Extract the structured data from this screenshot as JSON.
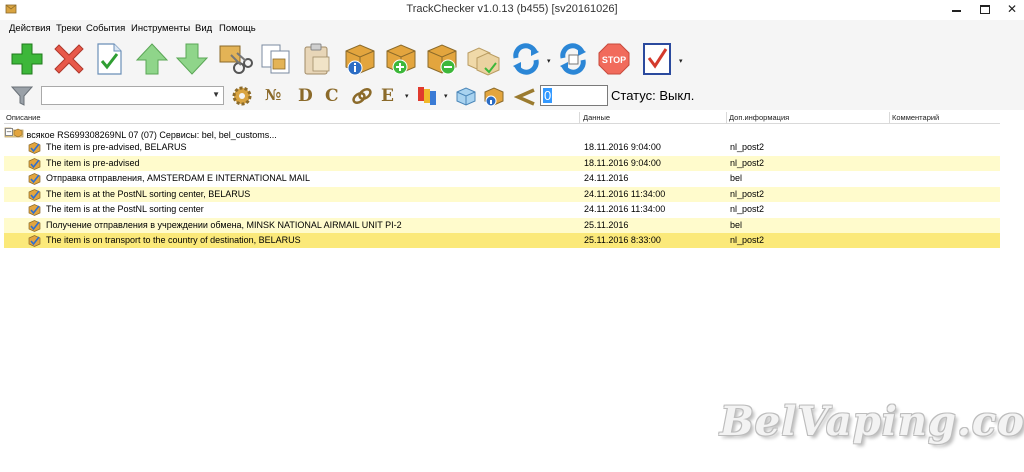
{
  "window": {
    "title": "TrackChecker v1.0.13 (b455)  [sv20161026]",
    "controls": [
      "—",
      "☐",
      "✕"
    ]
  },
  "menu": [
    "Действия",
    "Треки",
    "События",
    "Инструменты",
    "Вид",
    "Помощь"
  ],
  "toolbar2": {
    "filter_value": "",
    "letters": [
      "№",
      "D",
      "C",
      "E"
    ],
    "counter_value": "0",
    "status_label": "Статус: Выкл."
  },
  "grid": {
    "columns": [
      "Описание",
      "Данные",
      "Доп.информация",
      "Комментарий"
    ],
    "group": {
      "name": "всякое",
      "data": "RS699308269NL",
      "info": "07 (07) Сервисы: bel, bel_customs..."
    },
    "rows": [
      {
        "desc": "The item is pre-advised, BELARUS",
        "date": "18.11.2016 9:04:00",
        "info": "nl_post2",
        "style": "normal"
      },
      {
        "desc": "The item is pre-advised",
        "date": "18.11.2016 9:04:00",
        "info": "nl_post2",
        "style": "alt"
      },
      {
        "desc": "Отправка отправления, AMSTERDAM E INTERNATIONAL MAIL",
        "date": "24.11.2016",
        "info": "bel",
        "style": "normal"
      },
      {
        "desc": "The item is at the PostNL sorting center, BELARUS",
        "date": "24.11.2016 11:34:00",
        "info": "nl_post2",
        "style": "alt"
      },
      {
        "desc": "The item is at the PostNL sorting center",
        "date": "24.11.2016 11:34:00",
        "info": "nl_post2",
        "style": "normal"
      },
      {
        "desc": "Получение отправления в учреждении обмена, MINSK NATIONAL AIRMAIL UNIT PI-2",
        "date": "25.11.2016",
        "info": "bel",
        "style": "alt"
      },
      {
        "desc": "The item is on transport to the country of destination, BELARUS",
        "date": "25.11.2016 8:33:00",
        "info": "nl_post2",
        "style": "sel"
      }
    ]
  },
  "watermark": "BelVaping.com",
  "colors": {
    "row_alt": "#fffbcc",
    "row_selected": "#fbe97a",
    "accent_blue": "#3399ff",
    "add_green": "#3db73a",
    "delete_red": "#e8594a"
  }
}
